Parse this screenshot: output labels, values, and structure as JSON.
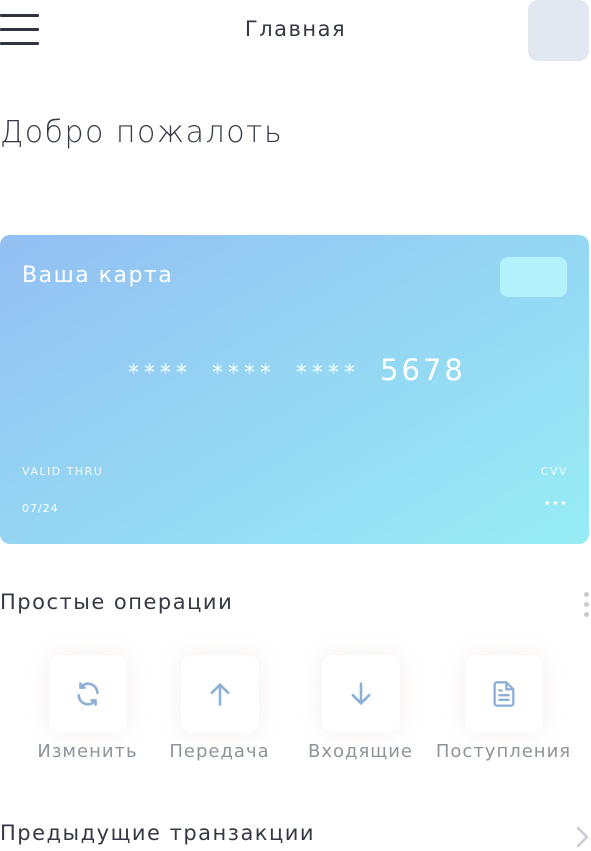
{
  "header": {
    "title": "Главная",
    "menu_icon": "hamburger-menu-icon",
    "avatar_color": "#e2e8ef"
  },
  "welcome": "Добро пожалоть",
  "card": {
    "label": "Ваша карта",
    "number_masked": [
      "****",
      "****",
      "****"
    ],
    "number_last4": "5678",
    "valid_thru_label": "VALID THRU",
    "valid_thru_value": "07/24",
    "cvv_label": "CVV",
    "cvv_value": "•••",
    "gradient_start": "#93bff3",
    "gradient_end": "#96ecf5",
    "chip_color": "#b4f2fb"
  },
  "operations": {
    "title": "Простые операции",
    "more_icon": "vertical-dots-icon",
    "items": [
      {
        "label": "Изменить",
        "icon": "refresh-icon"
      },
      {
        "label": "Передача",
        "icon": "arrow-up-icon"
      },
      {
        "label": "Входящие",
        "icon": "arrow-down-icon"
      },
      {
        "label": "Поступления",
        "icon": "document-icon"
      }
    ],
    "icon_color": "#8fb0d6"
  },
  "transactions": {
    "title": "Предыдущие транзакции",
    "icon": "chevron-right-icon"
  }
}
